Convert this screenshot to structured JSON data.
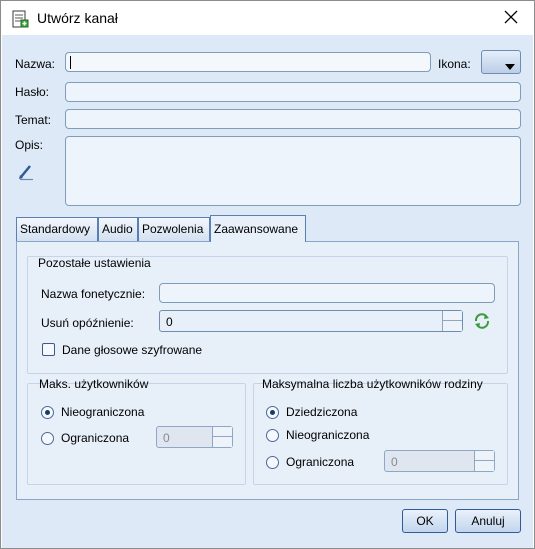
{
  "window": {
    "title": "Utwórz kanał",
    "app_icon": "notebook-edit-icon",
    "close_icon": "close-icon"
  },
  "form": {
    "name_label": "Nazwa:",
    "name_value": "",
    "icon_label": "Ikona:",
    "password_label": "Hasło:",
    "password_value": "",
    "topic_label": "Temat:",
    "topic_value": "",
    "description_label": "Opis:",
    "description_value": "",
    "edit_icon": "pen-edit-icon"
  },
  "tabs": [
    {
      "label": "Standardowy",
      "selected": false
    },
    {
      "label": "Audio",
      "selected": false
    },
    {
      "label": "Pozwolenia",
      "selected": false
    },
    {
      "label": "Zaawansowane",
      "selected": true
    }
  ],
  "advanced": {
    "other_settings_title": "Pozostałe ustawienia",
    "phonetic_name_label": "Nazwa fonetycznie:",
    "phonetic_name_value": "",
    "delete_delay_label": "Usuń opóźnienie:",
    "delete_delay_value": "0",
    "refresh_icon": "refresh-icon",
    "encrypted_voice_label": "Dane głosowe szyfrowane",
    "encrypted_voice_checked": false,
    "max_users": {
      "title": "Maks. użytkowników",
      "unlimited_label": "Nieograniczona",
      "limited_label": "Ograniczona",
      "selected": "unlimited",
      "limit_value": "0"
    },
    "max_family_users": {
      "title": "Maksymalna liczba użytkowników rodziny",
      "inherited_label": "Dziedziczona",
      "unlimited_label": "Nieograniczona",
      "limited_label": "Ograniczona",
      "selected": "inherited",
      "limit_value": "0"
    }
  },
  "buttons": {
    "ok_label": "OK",
    "cancel_label": "Anuluj"
  },
  "colors": {
    "client_bg": "#dde9f7",
    "panel_bg": "#e7eff9",
    "accent_border": "#2f5c96"
  }
}
